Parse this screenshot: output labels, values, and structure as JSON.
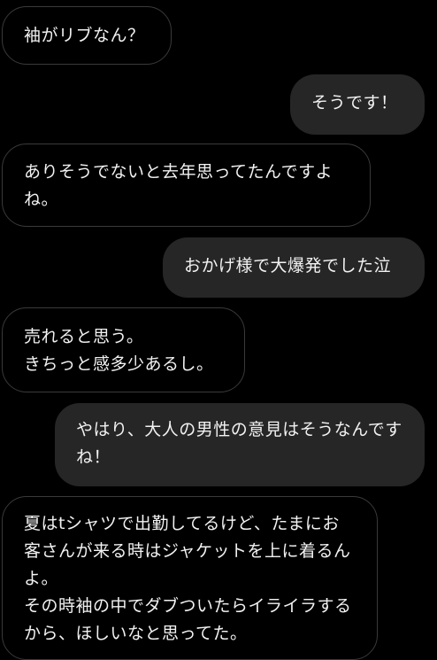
{
  "messages": [
    {
      "side": "incoming",
      "text": "袖がリブなん？"
    },
    {
      "side": "outgoing",
      "text": "そうです！"
    },
    {
      "side": "incoming",
      "text": "ありそうでないと去年思ってたんですよね。"
    },
    {
      "side": "outgoing",
      "text": "おかげ様で大爆発でした泣"
    },
    {
      "side": "incoming",
      "text": "売れると思う。\nきちっと感多少あるし。"
    },
    {
      "side": "outgoing",
      "text": "やはり、大人の男性の意見はそうなんですね！"
    },
    {
      "side": "incoming",
      "text": "夏はtシャツで出勤してるけど、たまにお客さんが来る時はジャケットを上に着るんよ。\nその時袖の中でダブついたらイライラするから、ほしいなと思ってた。"
    }
  ],
  "colors": {
    "background": "#000000",
    "incoming_bubble_fill": "#000000",
    "incoming_bubble_border": "#3a3a3a",
    "outgoing_bubble_fill": "#262626",
    "text": "#f2f2f2"
  }
}
